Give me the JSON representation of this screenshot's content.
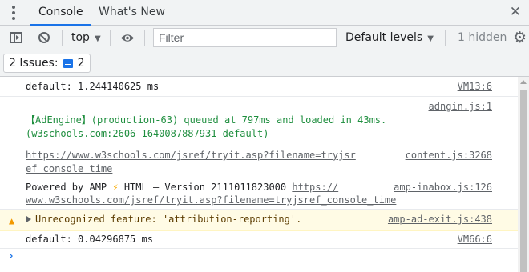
{
  "tabs": {
    "console": "Console",
    "whats_new": "What's New"
  },
  "toolbar": {
    "context": "top",
    "filter_placeholder": "Filter",
    "levels": "Default levels",
    "hidden": "1 hidden"
  },
  "issues": {
    "label": "2 Issues:",
    "count": "2"
  },
  "console": {
    "m1": {
      "text": "default: 1.244140625 ms",
      "src": "VM13:6"
    },
    "m2": {
      "src": "adngin.js:1",
      "line1": "【AdEngine】(production-63) queued at 797ms and loaded in 43ms.",
      "line2": "(w3schools.com:2606-1640087887931-default)"
    },
    "m3": {
      "line1": "https://www.w3schools.com/jsref/tryit.asp?filename=tryjsr",
      "line2": "ef_console_time",
      "src": "content.js:3268"
    },
    "m4": {
      "pre": "Powered by AMP ",
      "bolt": "⚡",
      "mid": " HTML – Version 2111011823000 ",
      "link1": "https://",
      "line2": "www.w3schools.com/jsref/tryit.asp?filename=tryjsref_console_time",
      "src": "amp-inabox.js:126"
    },
    "m5": {
      "text": "Unrecognized feature: 'attribution-reporting'.",
      "src": "amp-ad-exit.js:438"
    },
    "m6": {
      "text": "default: 0.04296875 ms",
      "src": "VM66:6"
    },
    "prompt": "›"
  },
  "colors": {
    "accent": "#1a73e8",
    "warning_bg": "#fffbe5",
    "warning_icon": "#f29900"
  }
}
